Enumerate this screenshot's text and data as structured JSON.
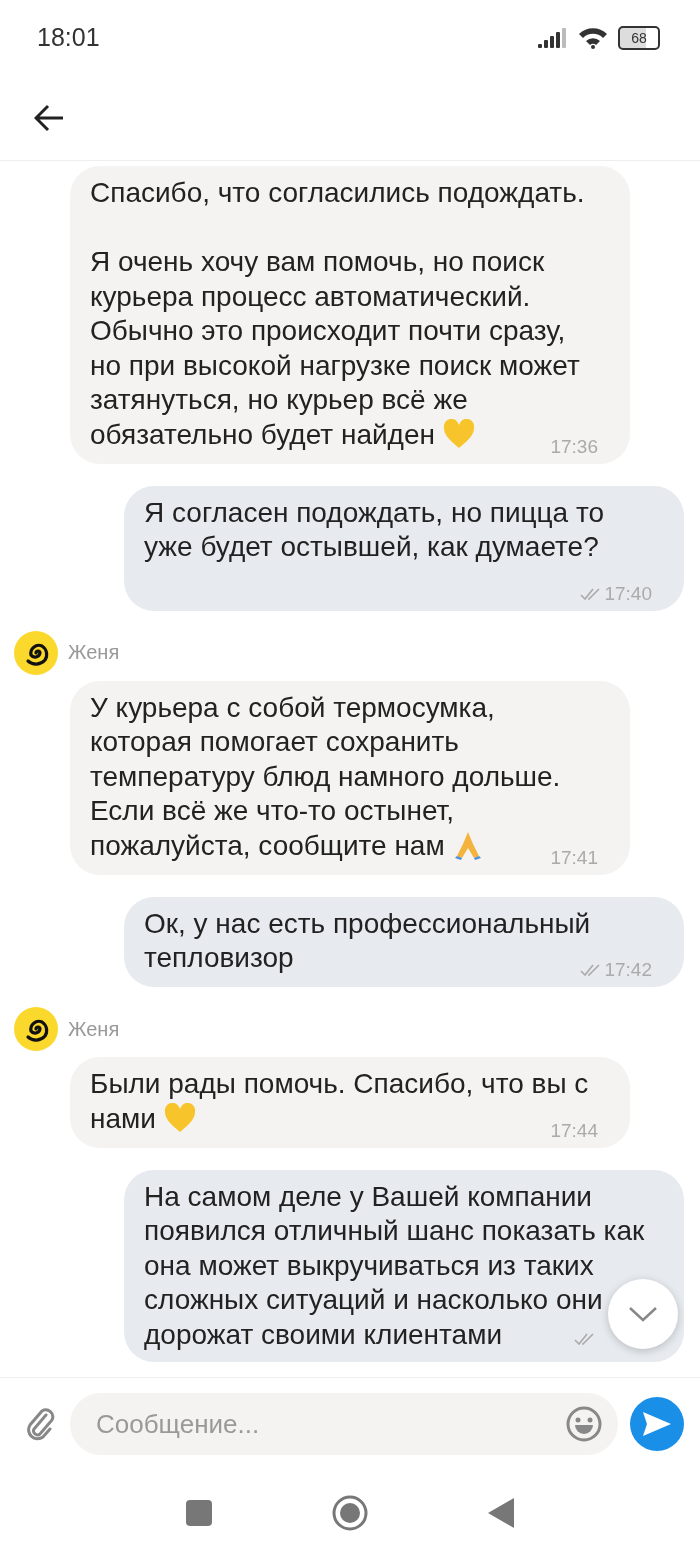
{
  "status_bar": {
    "time": "18:01",
    "battery": "68"
  },
  "messages": [
    {
      "kind": "incoming",
      "text": "Спасибо, что согласились подождать.\n\nЯ очень хочу вам помочь, но поиск курьера процесс автоматический. Обычно это происходит почти сразу, но при высокой нагрузке поиск может затянуться, но курьер всё же обязательно будет найден",
      "emoji": {
        "kind": "heart"
      },
      "time": "17:36"
    },
    {
      "kind": "outgoing",
      "text": "Я согласен подождать, но пицца то уже будет остывшей, как думаете?",
      "time": "17:40",
      "read": true
    },
    {
      "kind": "incoming",
      "sender": "Женя",
      "text": "У курьера с собой термосумка, которая помогает сохранить температуру блюд намного дольше. Если всё же что-то остынет, пожалуйста, сообщите нам",
      "emoji": {
        "kind": "pray"
      },
      "time": "17:41"
    },
    {
      "kind": "outgoing",
      "text": "Ок, у нас есть профессиональный тепловизор",
      "time": "17:42",
      "read": true
    },
    {
      "kind": "incoming",
      "sender": "Женя",
      "text": "Были рады помочь. Спасибо, что вы с нами",
      "emoji": {
        "kind": "heart"
      },
      "time": "17:44"
    },
    {
      "kind": "outgoing",
      "text": "На самом деле у Вашей компании появился отличный шанс показать как она может выкручиваться из таких сложных ситуаций и насколько они дорожат своими клиентами",
      "read": true
    }
  ],
  "composer": {
    "placeholder": "Сообщение..."
  }
}
